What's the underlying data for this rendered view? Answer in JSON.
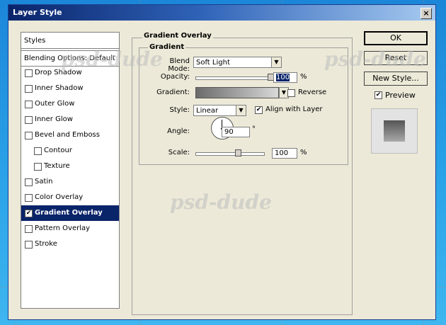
{
  "window": {
    "title": "Layer Style",
    "close_label": "×"
  },
  "styles_panel": {
    "header": "Styles",
    "blending_options": "Blending Options: Default",
    "effects": [
      {
        "label": "Drop Shadow",
        "checked": false,
        "indent": false
      },
      {
        "label": "Inner Shadow",
        "checked": false,
        "indent": false
      },
      {
        "label": "Outer Glow",
        "checked": false,
        "indent": false
      },
      {
        "label": "Inner Glow",
        "checked": false,
        "indent": false
      },
      {
        "label": "Bevel and Emboss",
        "checked": false,
        "indent": false
      },
      {
        "label": "Contour",
        "checked": false,
        "indent": true
      },
      {
        "label": "Texture",
        "checked": false,
        "indent": true
      },
      {
        "label": "Satin",
        "checked": false,
        "indent": false
      },
      {
        "label": "Color Overlay",
        "checked": false,
        "indent": false
      },
      {
        "label": "Gradient Overlay",
        "checked": true,
        "indent": false,
        "selected": true
      },
      {
        "label": "Pattern Overlay",
        "checked": false,
        "indent": false
      },
      {
        "label": "Stroke",
        "checked": false,
        "indent": false
      }
    ]
  },
  "gradient_overlay": {
    "section_title": "Gradient Overlay",
    "group_title": "Gradient",
    "blend_mode_label": "Blend Mode:",
    "blend_mode_value": "Soft Light",
    "opacity_label": "Opacity:",
    "opacity_value": "100",
    "opacity_unit": "%",
    "opacity_slider": 1.0,
    "gradient_label": "Gradient:",
    "reverse_label": "Reverse",
    "reverse_checked": false,
    "style_label": "Style:",
    "style_value": "Linear",
    "align_label": "Align with Layer",
    "align_checked": true,
    "angle_label": "Angle:",
    "angle_value": "90",
    "angle_unit": "°",
    "scale_label": "Scale:",
    "scale_value": "100",
    "scale_unit": "%",
    "scale_slider": 0.625
  },
  "buttons": {
    "ok": "OK",
    "reset": "Reset",
    "new_style": "New Style...",
    "preview_label": "Preview",
    "preview_checked": true
  },
  "watermark": "psd-dude",
  "icons": {
    "check": "✔",
    "dropdown": "▼"
  }
}
